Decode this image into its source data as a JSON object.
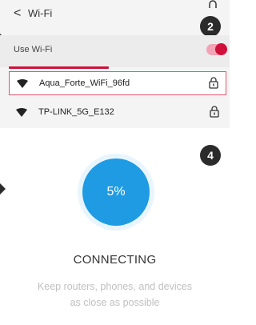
{
  "header": {
    "title": "Wi-Fi",
    "back_icon": "chevron-left-icon"
  },
  "wifi_toggle": {
    "label": "Use Wi-Fi",
    "on": true,
    "accent": "#d0103a"
  },
  "networks": [
    {
      "name": "Aqua_Forte_WiFi_96fd",
      "selected": true,
      "secured": true
    },
    {
      "name": "TP-LINK_5G_E132",
      "selected": false,
      "secured": true
    }
  ],
  "steps": {
    "first": "2",
    "second": "4"
  },
  "connecting": {
    "progress_label": "5%",
    "progress": 5,
    "status": "CONNECTING",
    "hint_line1": "Keep routers, phones, and devices",
    "hint_line2": "as close as possible",
    "accent": "#1e9be3"
  }
}
